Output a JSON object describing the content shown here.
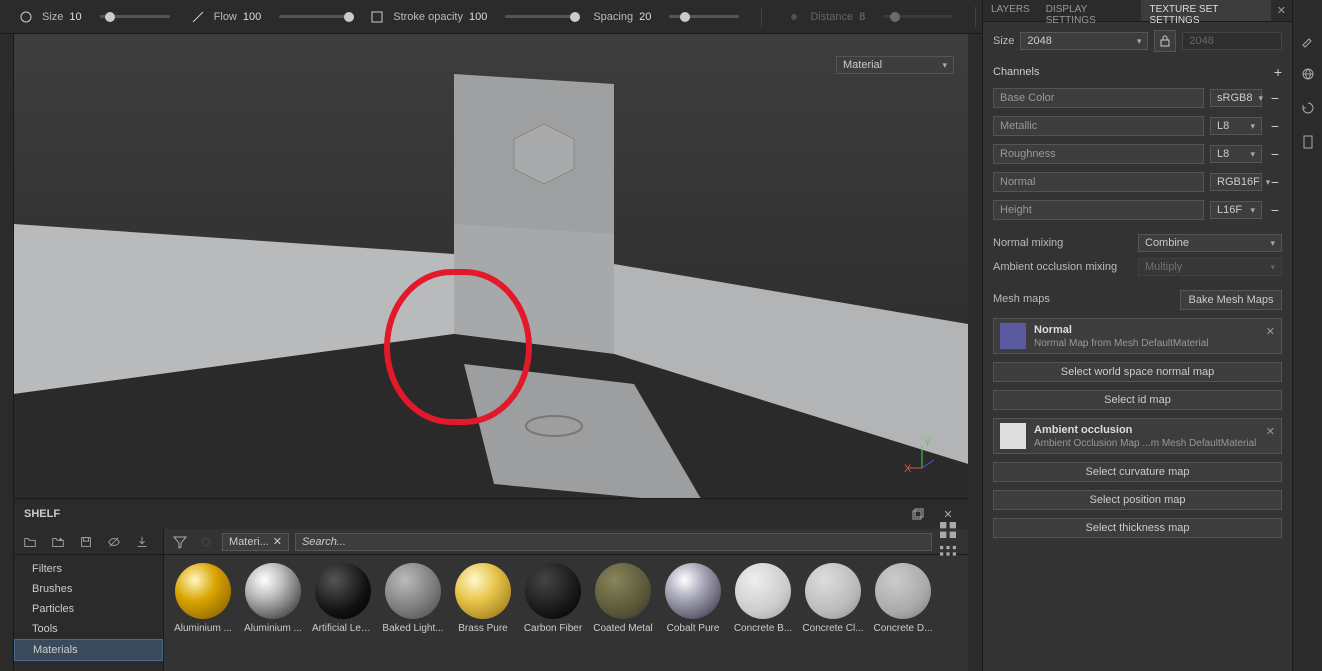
{
  "toolbar": {
    "size_label": "Size",
    "size_val": "10",
    "flow_label": "Flow",
    "flow_val": "100",
    "stroke_label": "Stroke opacity",
    "stroke_val": "100",
    "spacing_label": "Spacing",
    "spacing_val": "20",
    "distance_label": "Distance",
    "distance_val": "8"
  },
  "viewport": {
    "material_dropdown": "Material"
  },
  "panel": {
    "tabs": {
      "layers": "LAYERS",
      "display": "DISPLAY SETTINGS",
      "texset": "TEXTURE SET SETTINGS"
    },
    "size_label": "Size",
    "size_val": "2048",
    "size_locked": "2048",
    "channels_label": "Channels",
    "channels": [
      {
        "name": "Base Color",
        "fmt": "sRGB8"
      },
      {
        "name": "Metallic",
        "fmt": "L8"
      },
      {
        "name": "Roughness",
        "fmt": "L8"
      },
      {
        "name": "Normal",
        "fmt": "RGB16F"
      },
      {
        "name": "Height",
        "fmt": "L16F"
      }
    ],
    "normal_mixing_label": "Normal mixing",
    "normal_mixing_val": "Combine",
    "ao_mixing_label": "Ambient occlusion mixing",
    "ao_mixing_val": "Multiply",
    "meshmaps_label": "Mesh maps",
    "bake_label": "Bake Mesh Maps",
    "maps": {
      "normal_title": "Normal",
      "normal_sub": "Normal Map from Mesh DefaultMaterial",
      "ao_title": "Ambient occlusion",
      "ao_sub": "Ambient Occlusion Map ...m Mesh DefaultMaterial"
    },
    "select_buttons": [
      "Select world space normal map",
      "Select id map",
      "Select curvature map",
      "Select position map",
      "Select thickness map"
    ]
  },
  "shelf": {
    "title": "SHELF",
    "categories": [
      "Filters",
      "Brushes",
      "Particles",
      "Tools",
      "Materials"
    ],
    "filter_chip": "Materi...",
    "search_placeholder": "Search...",
    "materials": [
      "Aluminium ...",
      "Aluminium ...",
      "Artificial Lea...",
      "Baked Light...",
      "Brass Pure",
      "Carbon Fiber",
      "Coated Metal",
      "Cobalt Pure",
      "Concrete B...",
      "Concrete Cl...",
      "Concrete D..."
    ]
  }
}
